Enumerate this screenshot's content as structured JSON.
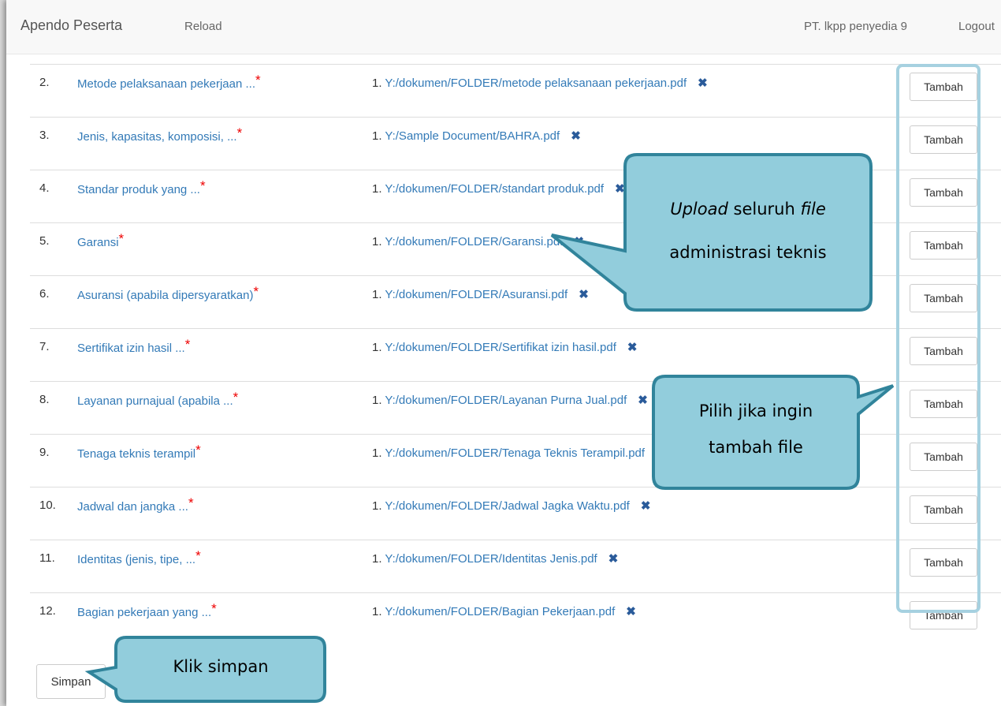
{
  "navbar": {
    "brand": "Apendo Peserta",
    "reload": "Reload",
    "user": "PT. lkpp penyedia 9",
    "logout": "Logout"
  },
  "rows": [
    {
      "num": "2.",
      "name": "Metode pelaksanaan pekerjaan ...",
      "file_index": "1.",
      "file": "Y:/dokumen/FOLDER/metode pelaksanaan pekerjaan.pdf",
      "button": "Tambah"
    },
    {
      "num": "3.",
      "name": "Jenis, kapasitas, komposisi, ...",
      "file_index": "1.",
      "file": "Y:/Sample Document/BAHRA.pdf",
      "button": "Tambah"
    },
    {
      "num": "4.",
      "name": "Standar produk yang ...",
      "file_index": "1.",
      "file": "Y:/dokumen/FOLDER/standart produk.pdf",
      "button": "Tambah"
    },
    {
      "num": "5.",
      "name": "Garansi",
      "file_index": "1.",
      "file": "Y:/dokumen/FOLDER/Garansi.pdf",
      "button": "Tambah"
    },
    {
      "num": "6.",
      "name": "Asuransi (apabila dipersyaratkan)",
      "file_index": "1.",
      "file": "Y:/dokumen/FOLDER/Asuransi.pdf",
      "button": "Tambah"
    },
    {
      "num": "7.",
      "name": "Sertifikat izin hasil ...",
      "file_index": "1.",
      "file": "Y:/dokumen/FOLDER/Sertifikat izin hasil.pdf",
      "button": "Tambah"
    },
    {
      "num": "8.",
      "name": "Layanan purnajual (apabila ...",
      "file_index": "1.",
      "file": "Y:/dokumen/FOLDER/Layanan Purna Jual.pdf",
      "button": "Tambah"
    },
    {
      "num": "9.",
      "name": "Tenaga teknis terampil",
      "file_index": "1.",
      "file": "Y:/dokumen/FOLDER/Tenaga Teknis Terampil.pdf",
      "button": "Tambah"
    },
    {
      "num": "10.",
      "name": "Jadwal dan jangka ...",
      "file_index": "1.",
      "file": "Y:/dokumen/FOLDER/Jadwal Jagka Waktu.pdf",
      "button": "Tambah"
    },
    {
      "num": "11.",
      "name": "Identitas (jenis, tipe, ...",
      "file_index": "1.",
      "file": "Y:/dokumen/FOLDER/Identitas Jenis.pdf",
      "button": "Tambah"
    },
    {
      "num": "12.",
      "name": "Bagian pekerjaan yang ...",
      "file_index": "1.",
      "file": "Y:/dokumen/FOLDER/Bagian Pekerjaan.pdf",
      "button": "Tambah"
    }
  ],
  "required_marker": "*",
  "delete_icon": "times-icon",
  "save_button": "Simpan",
  "callouts": {
    "upload": {
      "line1_em1": "Upload",
      "line1_mid": " seluruh ",
      "line1_em2": "file",
      "line2": "administrasi teknis"
    },
    "add": {
      "line1": "Pilih jika ingin",
      "line2": "tambah file"
    },
    "save": {
      "text": "Klik simpan"
    }
  },
  "colors": {
    "link": "#337ab7",
    "required": "#e00000",
    "callout_fill": "#92cddc",
    "callout_border": "#31849b",
    "highlight_border": "#a6d1e0"
  }
}
